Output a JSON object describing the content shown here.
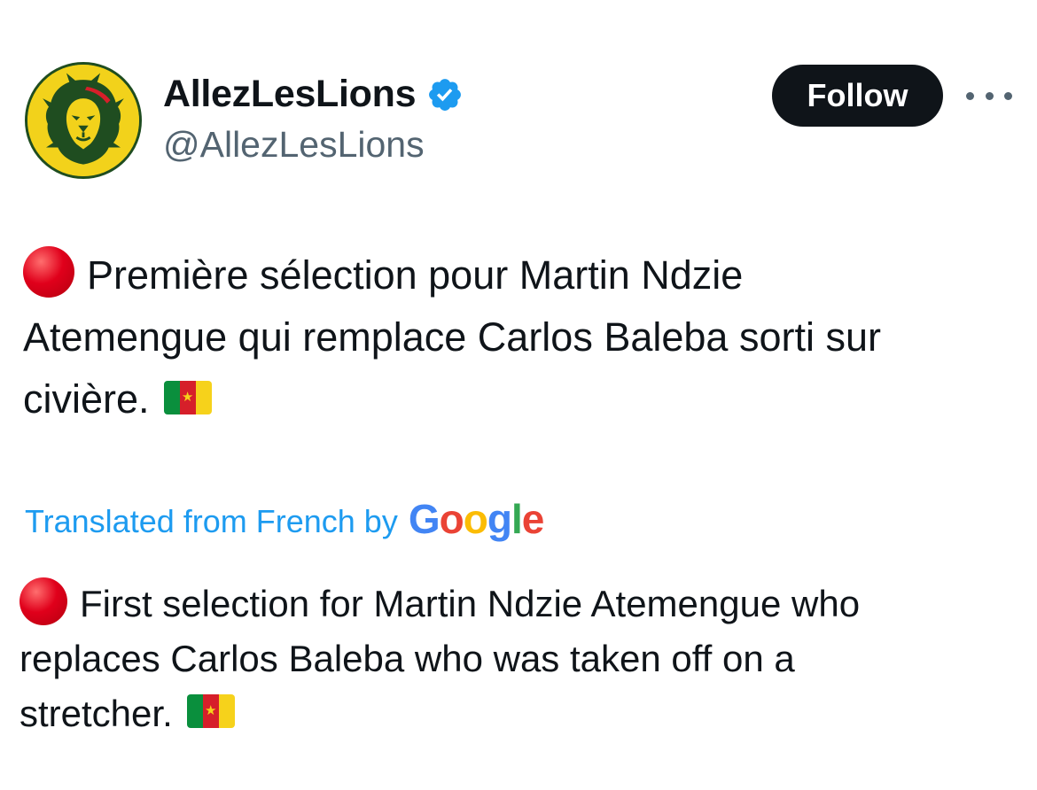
{
  "author": {
    "display_name": "AllezLesLions",
    "handle": "@AllezLesLions",
    "avatar_icon": "lion-head-logo",
    "verified_icon": "verified-badge-icon"
  },
  "actions": {
    "follow_label": "Follow",
    "more_icon": "more-options-icon"
  },
  "tweet": {
    "text_line_1": "Première sélection pour Martin Ndzie",
    "text_line_2": "Atemengue qui remplace Carlos Baleba sorti sur",
    "text_line_3": "civière.",
    "leading_emoji": "red-circle-emoji",
    "trailing_emoji": "cameroon-flag-emoji"
  },
  "translation": {
    "label": "Translated from French by",
    "provider_logo": "Google",
    "text_line_1": "First selection for Martin Ndzie Atemengue who",
    "text_line_2": "replaces Carlos Baleba who was taken off on a",
    "text_line_3": "stretcher."
  },
  "colors": {
    "link_blue": "#1d9bf0",
    "secondary_text": "#536471",
    "primary_text": "#0f1419",
    "avatar_yellow": "#f2d21b",
    "google_blue": "#4285F4",
    "google_red": "#EA4335",
    "google_yellow": "#FBBC05",
    "google_green": "#34A853"
  }
}
